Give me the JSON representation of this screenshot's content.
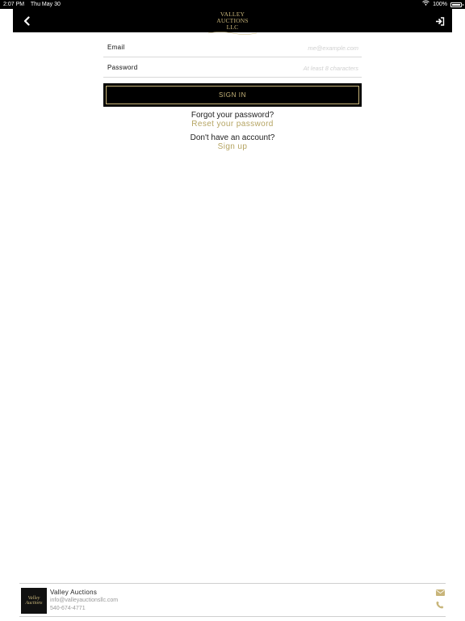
{
  "status_bar": {
    "time": "2:07 PM",
    "date": "Thu May 30",
    "battery": "100%"
  },
  "header": {
    "logo_line1": "VALLEY AUCTIONS",
    "logo_line2": "LLC"
  },
  "form": {
    "email_label": "Email",
    "email_placeholder": "me@example.com",
    "email_value": "",
    "password_label": "Password",
    "password_placeholder": "At least 8 characters",
    "password_value": "",
    "signin_label": "SIGN IN"
  },
  "links": {
    "forgot_text": "Forgot your password?",
    "reset_link": "Reset your password",
    "no_account_text": "Don't have an account?",
    "signup_link": "Sign up"
  },
  "footer": {
    "logo_text": "Valley Auctions",
    "name": "Valley Auctions",
    "email": "info@valleyauctionsllc.com",
    "phone": "540-674-4771"
  },
  "colors": {
    "black": "#000000",
    "gold": "#c8b57a",
    "link_gold": "#b5a462",
    "divider": "#d9d9d9"
  },
  "icons": {
    "back": "chevron-left-icon",
    "signin": "sign-in-icon",
    "wifi": "wifi-icon",
    "battery": "battery-icon",
    "mail": "envelope-icon",
    "phone": "phone-icon"
  }
}
